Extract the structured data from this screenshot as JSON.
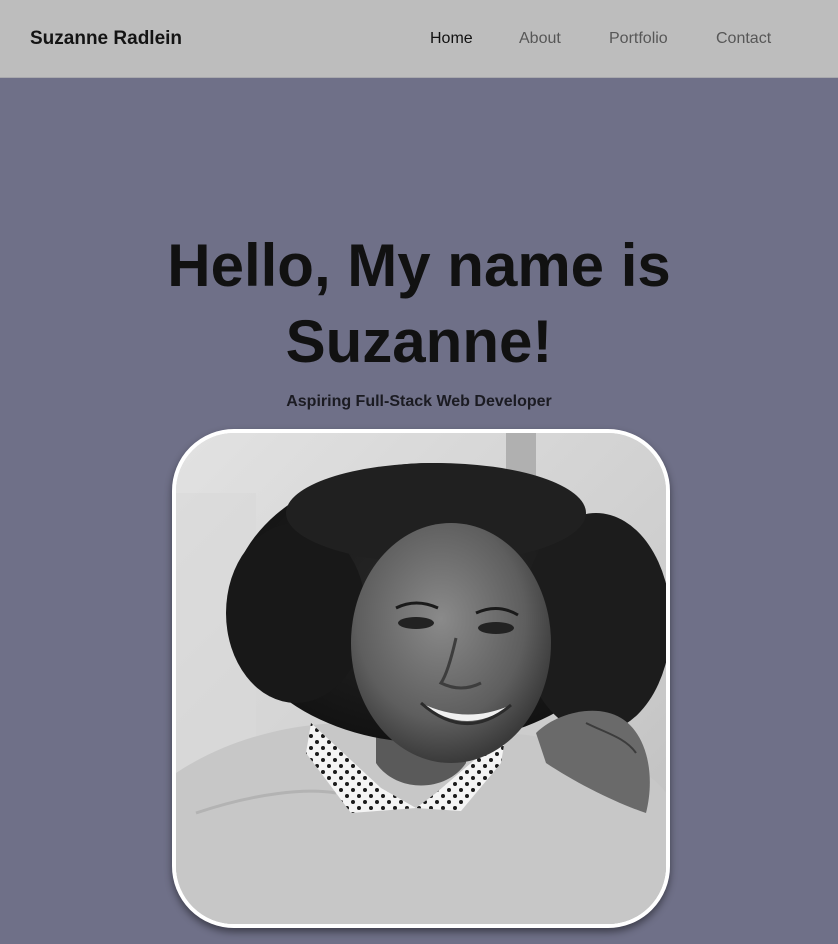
{
  "navbar": {
    "brand": "Suzanne Radlein",
    "links": [
      {
        "label": "Home",
        "active": true
      },
      {
        "label": "About",
        "active": false
      },
      {
        "label": "Portfolio",
        "active": false
      },
      {
        "label": "Contact",
        "active": false
      }
    ]
  },
  "hero": {
    "title_line1": "Hello, My name is",
    "title_line2": "Suzanne!",
    "subtitle": "Aspiring Full-Stack Web Developer"
  },
  "colors": {
    "navbar_bg": "#bdbdbd",
    "page_bg": "#6f7088",
    "text_dark": "#111111",
    "photo_border": "#ffffff"
  }
}
